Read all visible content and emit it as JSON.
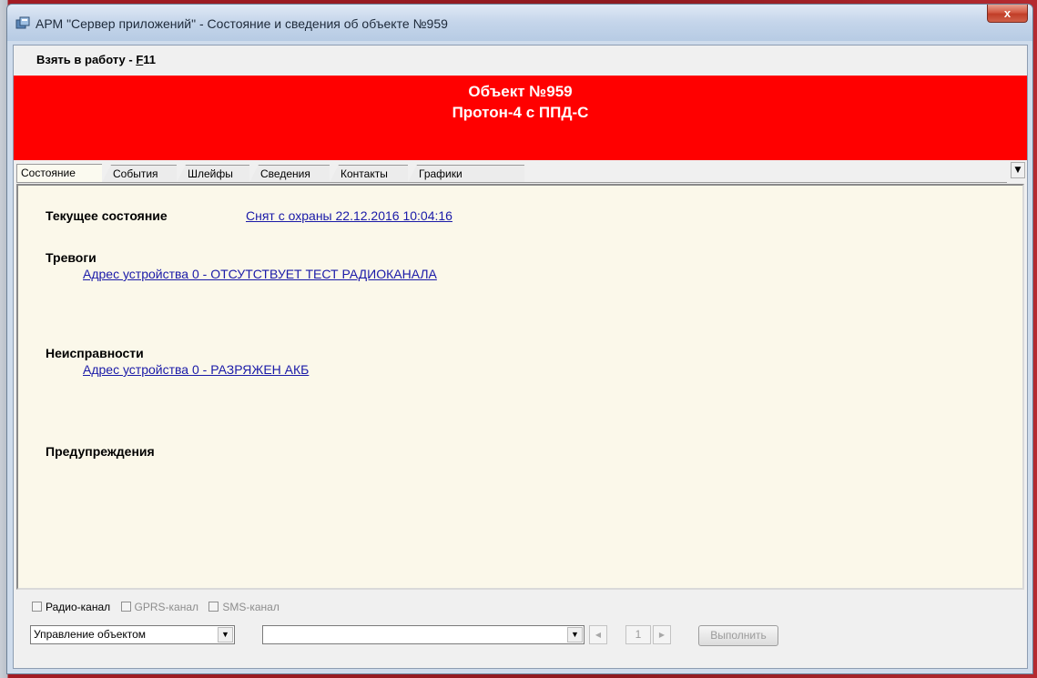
{
  "window": {
    "title": "АРМ \"Сервер приложений\" - Состояние и сведения об объекте №959",
    "close_label": "x"
  },
  "menubar": {
    "take_label": "Взять в работу - ",
    "take_key": "F",
    "take_key_rest": "11"
  },
  "banner": {
    "line1": "Объект №959",
    "line2": "Протон-4 с ППД-С",
    "color": "#ff0000"
  },
  "tabs": [
    {
      "label": "Состояние",
      "active": true
    },
    {
      "label": "События"
    },
    {
      "label": "Шлейфы"
    },
    {
      "label": "Сведения"
    },
    {
      "label": "Контакты"
    },
    {
      "label": "Графики"
    }
  ],
  "state": {
    "current_label": "Текущее состояние",
    "current_value": "Снят с охраны 22.12.2016 10:04:16",
    "alarms_label": "Тревоги",
    "alarms": [
      "Адрес устройства 0 - ОТСУТСТВУЕТ ТЕСТ РАДИОКАНАЛА"
    ],
    "faults_label": "Неисправности",
    "faults": [
      "Адрес устройства 0 - РАЗРЯЖЕН АКБ"
    ],
    "warnings_label": "Предупреждения",
    "link_color": "#1a1aa8"
  },
  "channels": [
    {
      "label": "Радио-канал",
      "enabled": true
    },
    {
      "label": "GPRS-канал",
      "enabled": false
    },
    {
      "label": "SMS-канал",
      "enabled": false
    }
  ],
  "controls": {
    "mode_value": "Управление объектом",
    "command_value": "",
    "page": "1",
    "execute_label": "Выполнить"
  },
  "icons": {
    "app": "app-icon",
    "close": "close-icon",
    "dropdown": "chevron-down-icon",
    "prev": "triangle-left-icon",
    "next": "triangle-right-icon"
  }
}
